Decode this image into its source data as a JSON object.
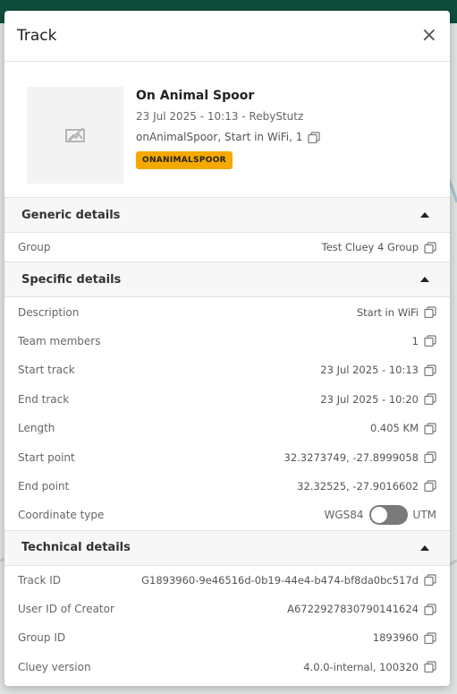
{
  "modal": {
    "title": "Track",
    "close_label": "×"
  },
  "track": {
    "name": "On Animal Spoor",
    "meta": "23 Jul 2025 - 10:13 - RebyStutz",
    "tags": "onAnimalSpoor, Start in WiFi, 1",
    "badge": "ONANIMALSPOOR",
    "badge_color": "#f5a900"
  },
  "sections": {
    "generic": {
      "title": "Generic details",
      "rows": [
        {
          "label": "Group",
          "value": "Test Cluey 4 Group"
        }
      ]
    },
    "specific": {
      "title": "Specific details",
      "rows": [
        {
          "label": "Description",
          "value": "Start in WiFi"
        },
        {
          "label": "Team members",
          "value": "1"
        },
        {
          "label": "Start track",
          "value": "23 Jul 2025 - 10:13"
        },
        {
          "label": "End track",
          "value": "23 Jul 2025 - 10:20"
        },
        {
          "label": "Length",
          "value": "0.405 KM"
        },
        {
          "label": "Start point",
          "value": "32.3273749, -27.8999058"
        },
        {
          "label": "End point",
          "value": "32.32525, -27.9016602"
        }
      ],
      "coordinate": {
        "label": "Coordinate type",
        "left": "WGS84",
        "right": "UTM"
      }
    },
    "technical": {
      "title": "Technical details",
      "rows": [
        {
          "label": "Track ID",
          "value": "G1893960-9e46516d-0b19-44e4-b474-bf8da0bc517d"
        },
        {
          "label": "User ID of Creator",
          "value": "A6722927830790141624"
        },
        {
          "label": "Group ID",
          "value": "1893960"
        },
        {
          "label": "Cluey version",
          "value": "4.0.0-internal, 100320"
        }
      ]
    }
  },
  "colors": {
    "header_bg": "#0e4d3c",
    "accent": "#f5a900"
  },
  "icons": {
    "thumbnail": "image-off-icon",
    "copy": "copy-icon",
    "close": "close-icon",
    "collapse": "caret-up-icon"
  }
}
